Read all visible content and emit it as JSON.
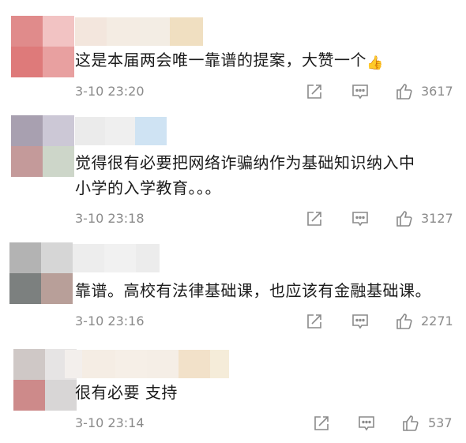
{
  "comments": [
    {
      "text": "这是本届两会唯一靠谱的提案，大赞一个",
      "emoji": "👍",
      "time": "3-10 23:20",
      "likes": "3617"
    },
    {
      "text_line1": "觉得很有必要把网络诈骗纳作为基础知识纳入中",
      "text_line2": "小学的入学教育。。。",
      "time": "3-10 23:18",
      "likes": "3127"
    },
    {
      "text": "靠谱。高校有法律基础课，也应该有金融基础课。",
      "time": "3-10 23:16",
      "likes": "2271"
    },
    {
      "text": "很有必要 支持",
      "time": "3-10 23:14",
      "likes": "537"
    }
  ],
  "colors": {
    "meta_text": "#8a8a8a",
    "icon_stroke": "#8a8a8a",
    "body_text": "#1b1b1b"
  }
}
